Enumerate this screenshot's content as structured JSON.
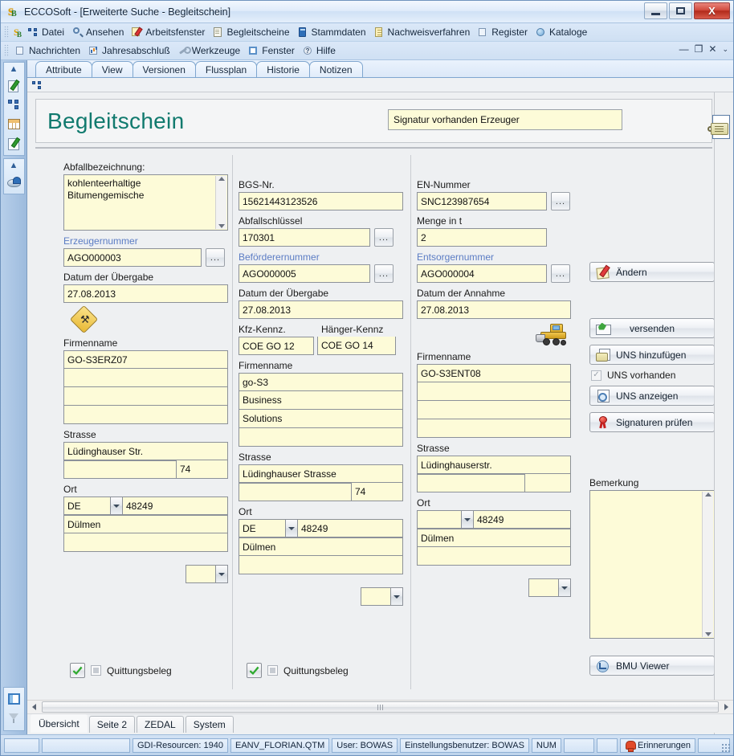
{
  "window": {
    "title": "ECCOSoft - [Erweiterte Suche - Begleitschein]",
    "app_icon": "eccosoft-icon",
    "minimize_label": "Minimieren",
    "maximize_label": "Maximieren",
    "close_label": "X"
  },
  "menubar": {
    "row1": [
      {
        "label": "Datei",
        "icon": "network-icon"
      },
      {
        "label": "Ansehen",
        "icon": "magnifier-icon"
      },
      {
        "label": "Arbeitsfenster",
        "icon": "pencil-note-icon"
      },
      {
        "label": "Begleitscheine",
        "icon": "document-icon"
      },
      {
        "label": "Stammdaten",
        "icon": "blue-book-icon"
      },
      {
        "label": "Nachweisverfahren",
        "icon": "yellow-list-icon"
      },
      {
        "label": "Register",
        "icon": "card-icon"
      },
      {
        "label": "Kataloge",
        "icon": "globe-icon"
      }
    ],
    "row2": [
      {
        "label": "Nachrichten",
        "icon": "message-icon"
      },
      {
        "label": "Jahresabschluß",
        "icon": "chart-icon"
      },
      {
        "label": "Werkzeuge",
        "icon": "wrench-icon"
      },
      {
        "label": "Fenster",
        "icon": "window-icon"
      },
      {
        "label": "Hilfe",
        "icon": "help-icon"
      }
    ],
    "mdi_controls": [
      "—",
      "❐",
      "✕",
      "⌄"
    ]
  },
  "left_rail": {
    "group1": {
      "chevron": "chevron-up-icon",
      "buttons": [
        "edit-document-icon",
        "network-nodes-icon",
        "table-grid-icon",
        "note-pencil-icon"
      ]
    },
    "group2": {
      "chevron": "chevron-up-icon",
      "buttons": [
        "disc-icon"
      ]
    },
    "bottom_buttons": [
      "window-pane-icon",
      "filter-funnel-icon"
    ]
  },
  "tabs": [
    {
      "label": "Attribute"
    },
    {
      "label": "View"
    },
    {
      "label": "Versionen"
    },
    {
      "label": "Flussplan"
    },
    {
      "label": "Historie"
    },
    {
      "label": "Notizen"
    }
  ],
  "form": {
    "title": "Begleitschein",
    "signature_status": "Signatur vorhanden Erzeuger",
    "col1": {
      "abfallbezeichnung_label": "Abfallbezeichnung:",
      "abfallbezeichnung_value": "kohlenteerhaltige\nBitumengemische",
      "erzeugernummer_label": "Erzeugernummer",
      "erzeugernummer_value": "AGO000003",
      "datum_label": "Datum der Übergabe",
      "datum_value": "27.08.2013",
      "icon": "hazard-excavation-icon",
      "firmenname_label": "Firmenname",
      "firmenname_lines": [
        "GO-S3ERZ07",
        "",
        "",
        ""
      ],
      "strasse_label": "Strasse",
      "strasse_value": "Lüdinghauser Str.",
      "strasse_extra": "",
      "hausnummer": "74",
      "ort_label": "Ort",
      "land": "DE",
      "plz": "48249",
      "stadt": "Dülmen",
      "ort_extra": "",
      "dropdown_value": ""
    },
    "col2": {
      "bgsnr_label": "BGS-Nr.",
      "bgsnr_value": "15621443123526",
      "abfallschluessel_label": "Abfallschlüssel",
      "abfallschluessel_value": "170301",
      "befoerderernummer_label": "Beförderernummer",
      "befoerderernummer_value": "AGO000005",
      "datum_label": "Datum der Übergabe",
      "datum_value": "27.08.2013",
      "kfz_label": "Kfz-Kennz.",
      "kfz_value": "COE GO 12",
      "haenger_label": "Hänger-Kennz",
      "haenger_value": "COE GO 14",
      "firmenname_label": "Firmenname",
      "firmenname_lines": [
        "go-S3",
        "Business",
        "Solutions",
        ""
      ],
      "strasse_label": "Strasse",
      "strasse_value": "Lüdinghauser Strasse",
      "strasse_extra": "",
      "hausnummer": "74",
      "ort_label": "Ort",
      "land": "DE",
      "plz": "48249",
      "stadt": "Dülmen",
      "ort_extra": "",
      "dropdown_value": ""
    },
    "col3": {
      "ennummer_label": "EN-Nummer",
      "ennummer_value": "SNC123987654",
      "menge_label": "Menge in t",
      "menge_value": "2",
      "entsorgernummer_label": "Entsorgernummer",
      "entsorgernummer_value": "AGO000004",
      "datum_label": "Datum der Annahme",
      "datum_value": "27.08.2013",
      "icon": "wheel-loader-icon",
      "firmenname_label": "Firmenname",
      "firmenname_lines": [
        "GO-S3ENT08",
        "",
        "",
        ""
      ],
      "strasse_label": "Strasse",
      "strasse_value": "Lüdinghauserstr.",
      "strasse_extra": "",
      "hausnummer": "",
      "ort_label": "Ort",
      "land": "",
      "plz": "48249",
      "stadt": "Dülmen",
      "ort_extra": "",
      "dropdown_value": ""
    },
    "ellipsis_button_label": "...",
    "checkboxes": [
      {
        "label": "Quittungsbeleg",
        "green_checked": true,
        "box_checked": false
      },
      {
        "label": "Quittungsbeleg",
        "green_checked": true,
        "box_checked": false
      }
    ]
  },
  "side_panel": {
    "aendern": {
      "label": "Ändern",
      "icon": "edit-pencil-icon"
    },
    "versenden": {
      "label": "versenden",
      "icon": "mail-send-icon"
    },
    "uns_hinzufuegen": {
      "label": "UNS hinzufügen",
      "icon": "uns-add-icon"
    },
    "uns_vorhanden": {
      "label": "UNS vorhanden",
      "checked": true
    },
    "uns_anzeigen": {
      "label": "UNS anzeigen",
      "icon": "uns-view-icon"
    },
    "signaturen_pruefen": {
      "label": "Signaturen prüfen",
      "icon": "seal-icon"
    },
    "bemerkung_label": "Bemerkung",
    "bemerkung_value": "",
    "bmu_viewer": {
      "label": "BMU Viewer",
      "icon": "bmu-icon"
    }
  },
  "page_tabs": [
    {
      "label": "Übersicht",
      "active": true
    },
    {
      "label": "Seite 2",
      "active": false
    },
    {
      "label": "ZEDAL",
      "active": false
    },
    {
      "label": "System",
      "active": false
    }
  ],
  "statusbar": {
    "gdi": "GDI-Resourcen: 1940",
    "file": "EANV_FLORIAN.QTM",
    "user": "User: BOWAS",
    "settings_user": "Einstellungsbenutzer: BOWAS",
    "num": "NUM",
    "reminders": "Erinnerungen",
    "reminders_icon": "bell-icon"
  }
}
